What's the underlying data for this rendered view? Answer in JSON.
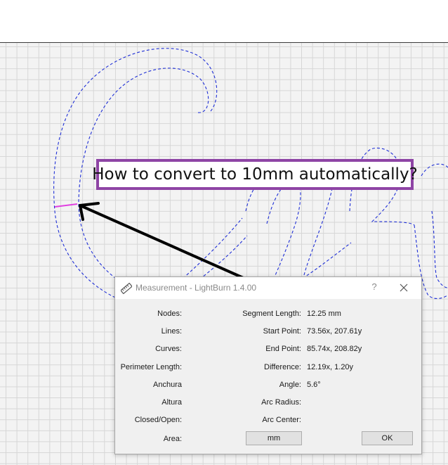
{
  "annotation": {
    "text": "How to convert to 10mm automatically?"
  },
  "dialog": {
    "title": "Measurement - LightBurn 1.4.00",
    "help": "?",
    "left_fields": [
      {
        "label": "Nodes:"
      },
      {
        "label": "Lines:"
      },
      {
        "label": "Curves:"
      },
      {
        "label": "Perimeter Length:"
      },
      {
        "label": "Anchura"
      },
      {
        "label": "Altura"
      },
      {
        "label": "Closed/Open:"
      },
      {
        "label": "Area:"
      }
    ],
    "right_fields": [
      {
        "label": "Segment Length:",
        "value": "12.25 mm"
      },
      {
        "label": "Start Point:",
        "value": "73.56x, 207.61y"
      },
      {
        "label": "End Point:",
        "value": "85.74x, 208.82y"
      },
      {
        "label": "Difference:",
        "value": "12.19x, 1.20y"
      },
      {
        "label": "Angle:",
        "value": "5.6°"
      },
      {
        "label": "Arc Radius:",
        "value": ""
      },
      {
        "label": "Arc Center:",
        "value": ""
      }
    ],
    "units_button": "mm",
    "ok_button": "OK"
  },
  "colors": {
    "outline": "#1f2fd6",
    "measure_segment": "#e040e0",
    "annotation_border": "#8e44a5",
    "arrow": "#000000"
  }
}
